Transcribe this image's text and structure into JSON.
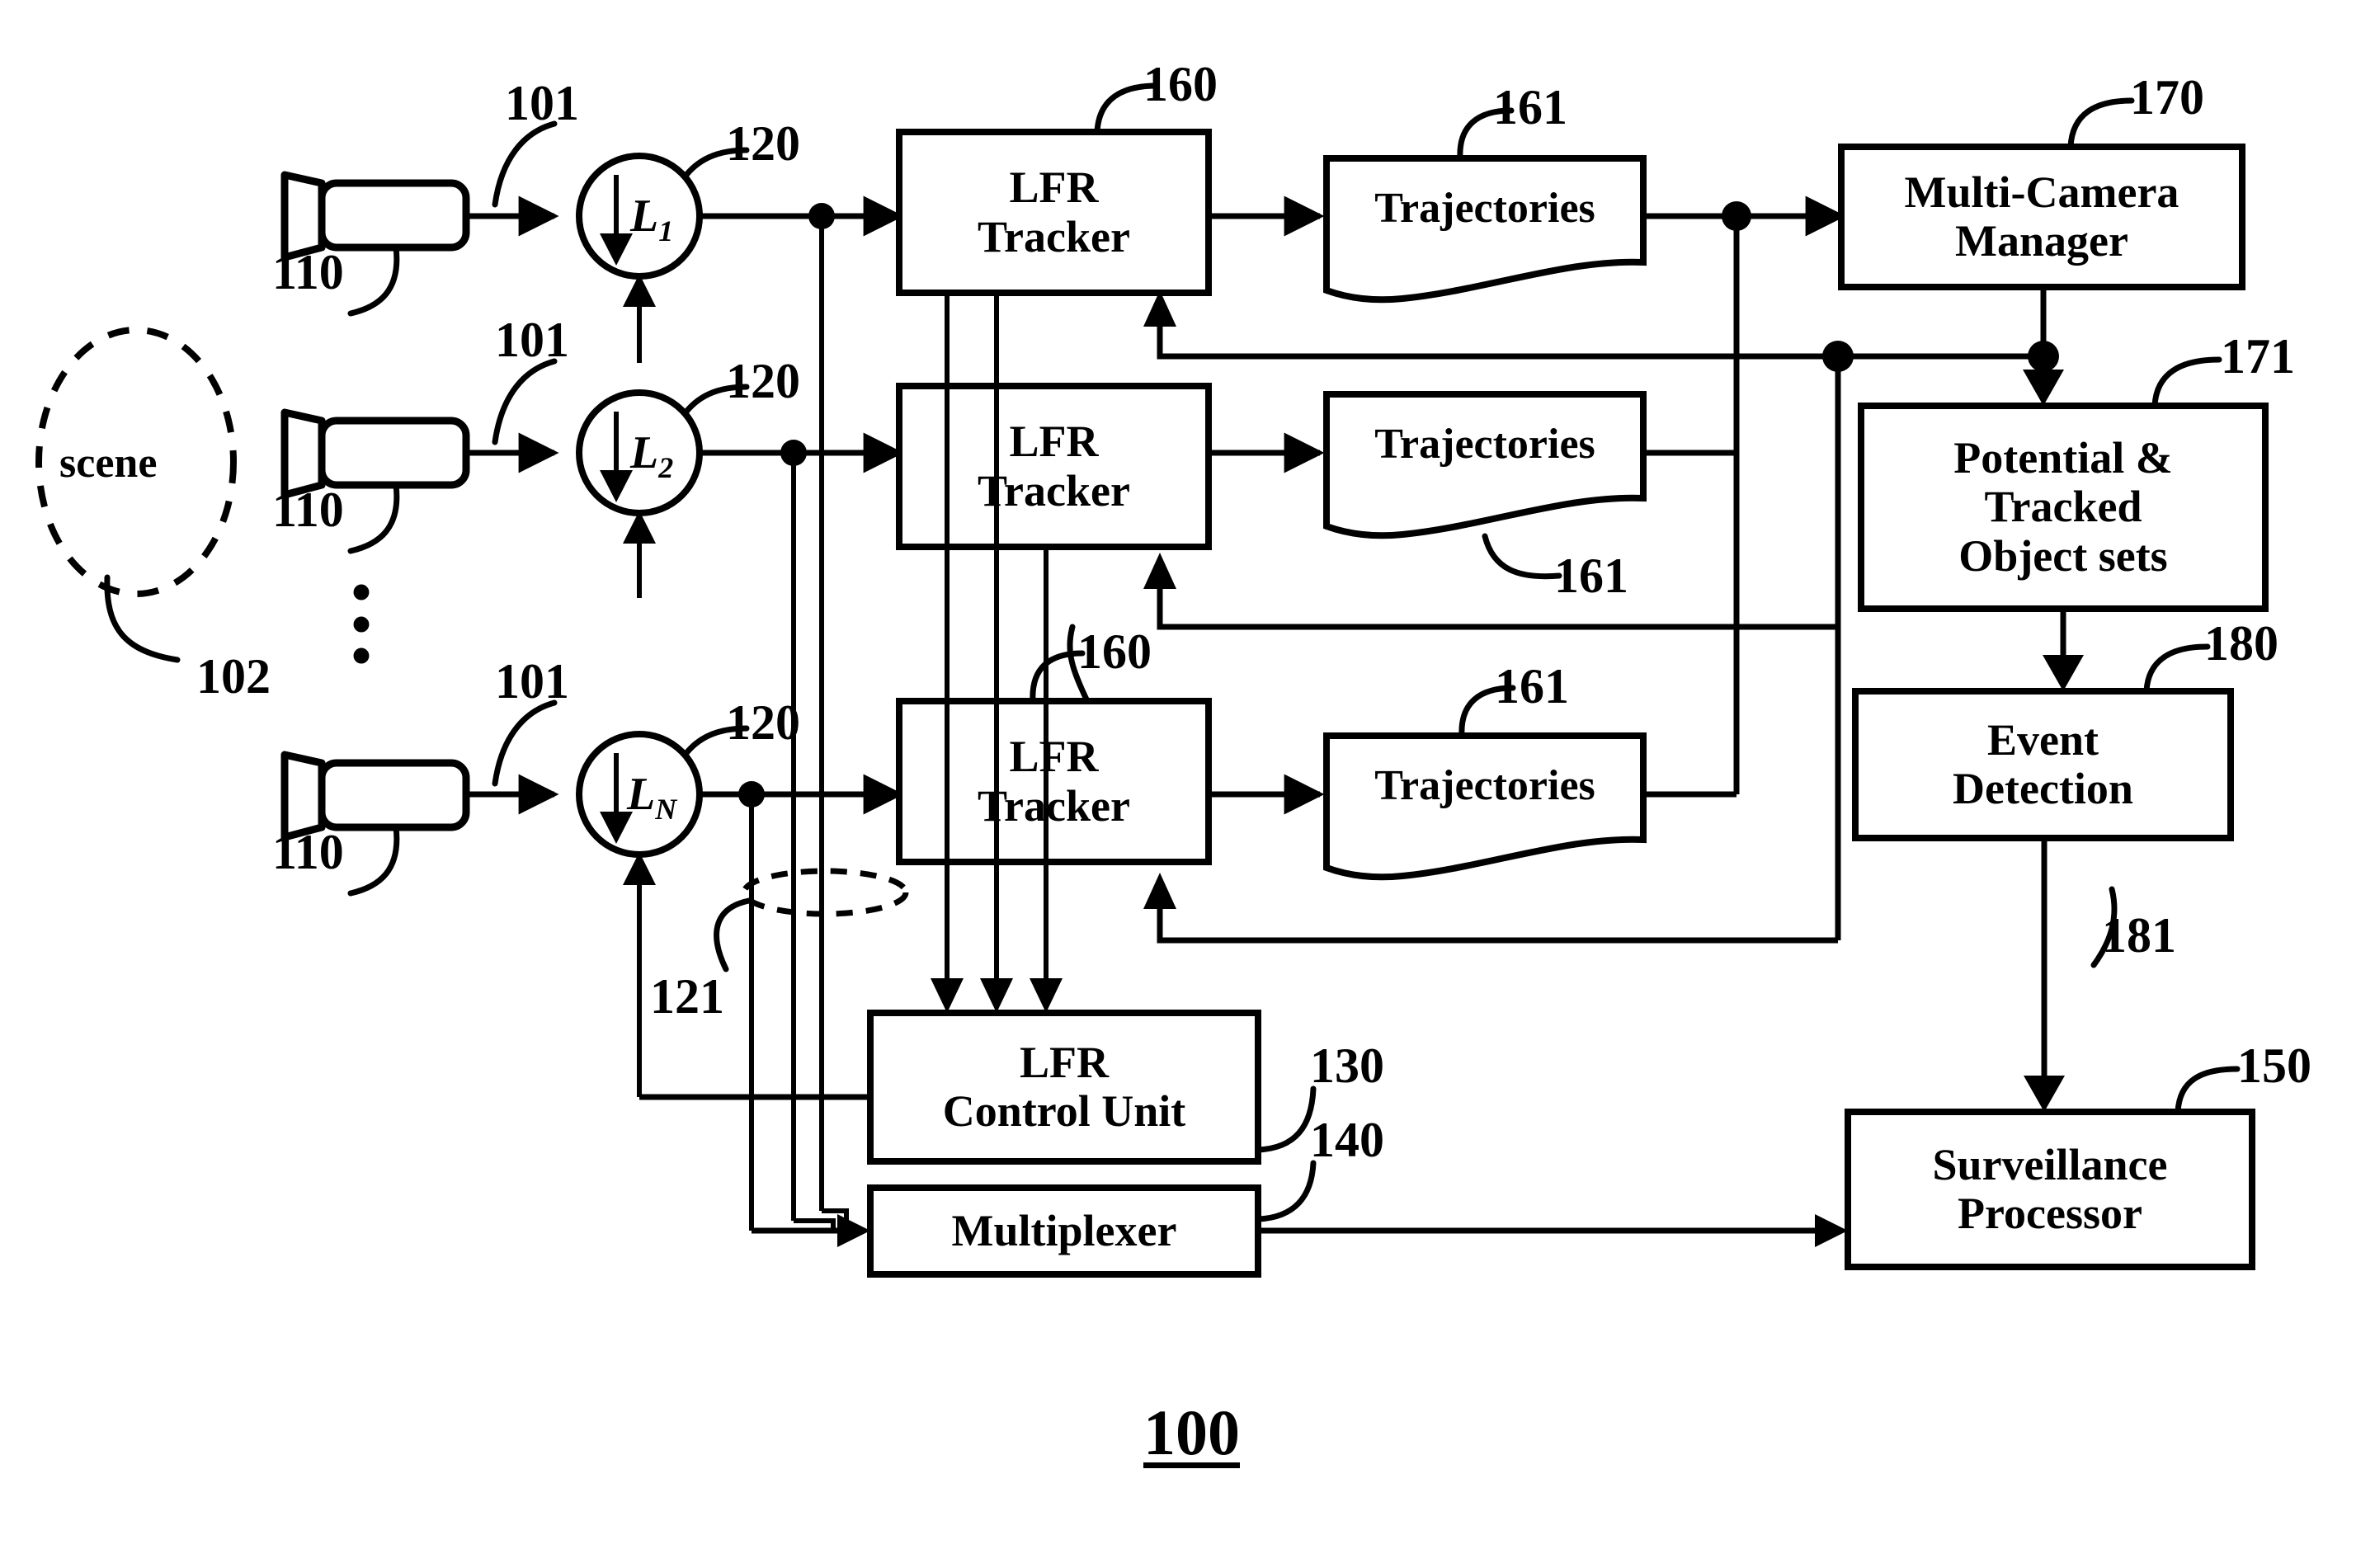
{
  "figure": {
    "caption": "100",
    "scene_label": "scene"
  },
  "nodes": {
    "scene": {
      "label": "scene",
      "ref": "102"
    },
    "cameras": [
      {
        "name": "camera-1",
        "ref": "110",
        "out_ref": "101"
      },
      {
        "name": "camera-2",
        "ref": "110",
        "out_ref": "101"
      },
      {
        "name": "camera-n",
        "ref": "110",
        "out_ref": "101"
      }
    ],
    "downsamplers": [
      {
        "name": "downsampler-1",
        "symbol": "L",
        "subscript": "1",
        "ref": "120",
        "arrow": "down-arrow-icon"
      },
      {
        "name": "downsampler-2",
        "symbol": "L",
        "subscript": "2",
        "ref": "120",
        "arrow": "down-arrow-icon"
      },
      {
        "name": "downsampler-n",
        "symbol": "L",
        "subscript": "N",
        "ref": "120",
        "arrow": "down-arrow-icon"
      }
    ],
    "control_feedback_ref": "121",
    "trackers": [
      {
        "name": "lfr-tracker-1",
        "line1": "LFR",
        "line2": "Tracker",
        "ref": "160"
      },
      {
        "name": "lfr-tracker-2",
        "line1": "LFR",
        "line2": "Tracker",
        "ref": "160"
      },
      {
        "name": "lfr-tracker-n",
        "line1": "LFR",
        "line2": "Tracker",
        "ref": "160"
      }
    ],
    "trajectories": [
      {
        "name": "trajectories-1",
        "label": "Trajectories",
        "ref": "161"
      },
      {
        "name": "trajectories-2",
        "label": "Trajectories",
        "ref": "161"
      },
      {
        "name": "trajectories-n",
        "label": "Trajectories",
        "ref": "161"
      }
    ],
    "multi_camera_manager": {
      "line1": "Multi-Camera",
      "line2": "Manager",
      "ref": "170"
    },
    "object_sets": {
      "line1": "Potential &",
      "line2": "Tracked",
      "line3": "Object sets",
      "ref": "171"
    },
    "event_detection": {
      "line1": "Event",
      "line2": "Detection",
      "ref": "180",
      "out_ref": "181"
    },
    "surveillance_processor": {
      "line1": "Surveillance",
      "line2": "Processor",
      "ref": "150"
    },
    "lfr_control_unit": {
      "line1": "LFR",
      "line2": "Control Unit",
      "ref": "130"
    },
    "multiplexer": {
      "label": "Multiplexer",
      "ref": "140"
    }
  },
  "ref_numerals": {
    "r100": "100",
    "r101": "101",
    "r102": "102",
    "r110": "110",
    "r120": "120",
    "r121": "121",
    "r130": "130",
    "r140": "140",
    "r150": "150",
    "r160": "160",
    "r161": "161",
    "r170": "170",
    "r171": "171",
    "r180": "180",
    "r181": "181"
  },
  "colors": {
    "ink": "#000000",
    "paper": "#ffffff"
  },
  "ellipsis": "•\n•\n•"
}
